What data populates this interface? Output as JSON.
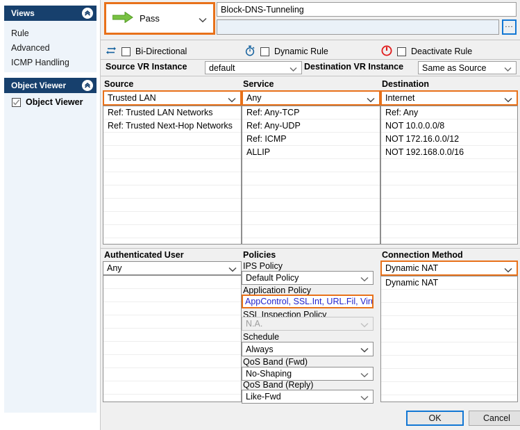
{
  "sidebar": {
    "views": {
      "title": "Views",
      "collapse_icon": "chevron-up-icon",
      "items": [
        {
          "label": "Rule"
        },
        {
          "label": "Advanced"
        },
        {
          "label": "ICMP Handling"
        }
      ]
    },
    "object_viewer": {
      "title": "Object Viewer",
      "collapse_icon": "chevron-up-icon",
      "checkbox_label": "Object Viewer",
      "checked": true
    }
  },
  "header": {
    "action": {
      "label": "Pass",
      "icon": "green-right-arrow-icon",
      "highlight_color": "#e8711a"
    },
    "rule_name": "Block-DNS-Tunneling",
    "rule_name_placeholder": "",
    "description": "",
    "description_placeholder": "",
    "browse_button": "..."
  },
  "options": {
    "bi_directional": {
      "label": "Bi-Directional",
      "checked": false,
      "icon": "bidirectional-arrows-icon"
    },
    "dynamic_rule": {
      "label": "Dynamic Rule",
      "checked": false,
      "icon": "stopwatch-icon"
    },
    "deactivate_rule": {
      "label": "Deactivate Rule",
      "checked": false,
      "icon": "power-icon"
    }
  },
  "vr": {
    "source_label": "Source VR Instance",
    "source_value": "default",
    "destination_label": "Destination VR Instance",
    "destination_value": "Same as Source"
  },
  "source": {
    "title": "Source",
    "selected": "Trusted  LAN",
    "items": [
      "Ref: Trusted LAN Networks",
      "Ref: Trusted Next-Hop Networks"
    ]
  },
  "service": {
    "title": "Service",
    "selected": "Any",
    "items": [
      "Ref: Any-TCP",
      "Ref: Any-UDP",
      "Ref: ICMP",
      "ALLIP"
    ]
  },
  "destination": {
    "title": "Destination",
    "selected": "Internet",
    "items": [
      "Ref: Any",
      "NOT 10.0.0.0/8",
      "NOT 172.16.0.0/12",
      "NOT 192.168.0.0/16"
    ]
  },
  "authenticated_user": {
    "title": "Authenticated User",
    "selected": "Any",
    "items": []
  },
  "policies": {
    "title": "Policies",
    "ips_label": "IPS Policy",
    "ips_value": "Default Policy",
    "application_label": "Application Policy",
    "application_value": "AppControl, SSL.Int, URL.Fil, Virus Sc...",
    "ssl_label": "SSL Inspection Policy",
    "ssl_value": "N.A.",
    "ssl_disabled": true,
    "schedule_label": "Schedule",
    "schedule_value": "Always",
    "qos_fwd_label": "QoS Band (Fwd)",
    "qos_fwd_value": "No-Shaping",
    "qos_reply_label": "QoS Band (Reply)",
    "qos_reply_value": "Like-Fwd"
  },
  "connection_method": {
    "title": "Connection Method",
    "selected": "Dynamic NAT",
    "items": [
      "Dynamic NAT"
    ]
  },
  "footer": {
    "ok": "OK",
    "cancel": "Cancel"
  }
}
